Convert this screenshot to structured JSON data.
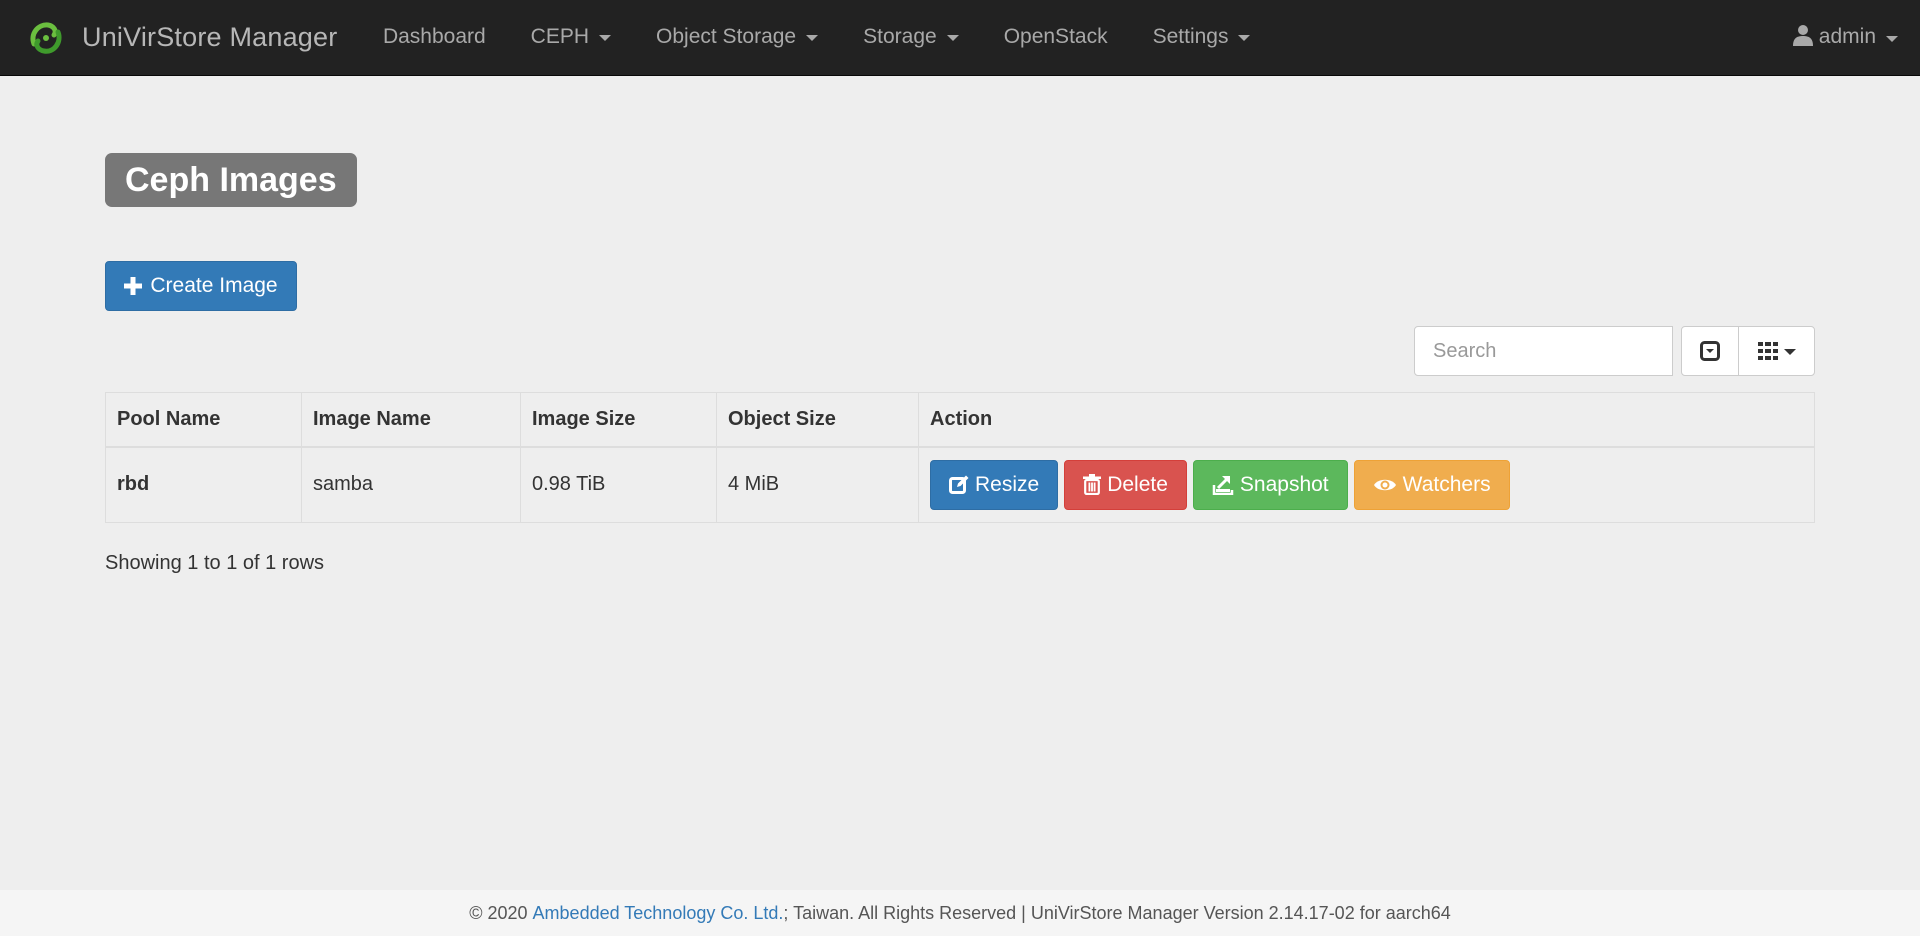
{
  "navbar": {
    "brand": "UniVirStore Manager",
    "items": [
      {
        "label": "Dashboard",
        "dropdown": false
      },
      {
        "label": "CEPH",
        "dropdown": true
      },
      {
        "label": "Object Storage",
        "dropdown": true
      },
      {
        "label": "Storage",
        "dropdown": true
      },
      {
        "label": "OpenStack",
        "dropdown": false
      },
      {
        "label": "Settings",
        "dropdown": true
      }
    ],
    "user": "admin",
    "icons": {
      "brand": "swirl-logo-icon",
      "user": "user-icon",
      "dropdown": "caret-down-icon"
    }
  },
  "page": {
    "title": "Ceph Images",
    "create_button": "Create Image",
    "create_icon": "plus-icon"
  },
  "toolbar": {
    "search_placeholder": "Search",
    "toggle_icon": "toggle-view-icon",
    "columns_icon": "grid-columns-icon"
  },
  "table": {
    "headers": [
      "Pool Name",
      "Image Name",
      "Image Size",
      "Object Size",
      "Action"
    ],
    "rows": [
      {
        "pool": "rbd",
        "image": "samba",
        "size": "0.98 TiB",
        "object_size": "4 MiB"
      }
    ],
    "actions": {
      "resize": "Resize",
      "delete": "Delete",
      "snapshot": "Snapshot",
      "watchers": "Watchers"
    },
    "info": "Showing 1 to 1 of 1 rows"
  },
  "footer": {
    "prefix": "© 2020 ",
    "company": "Ambedded Technology Co. Ltd.",
    "suffix": "; Taiwan. All Rights Reserved | UniVirStore Manager Version 2.14.17-02 for aarch64"
  },
  "colors": {
    "navbar_bg": "#222222",
    "primary": "#337ab7",
    "danger": "#d9534f",
    "success": "#5cb85c",
    "warning": "#f0ad4e",
    "logo_green": "#6bbf3f"
  }
}
